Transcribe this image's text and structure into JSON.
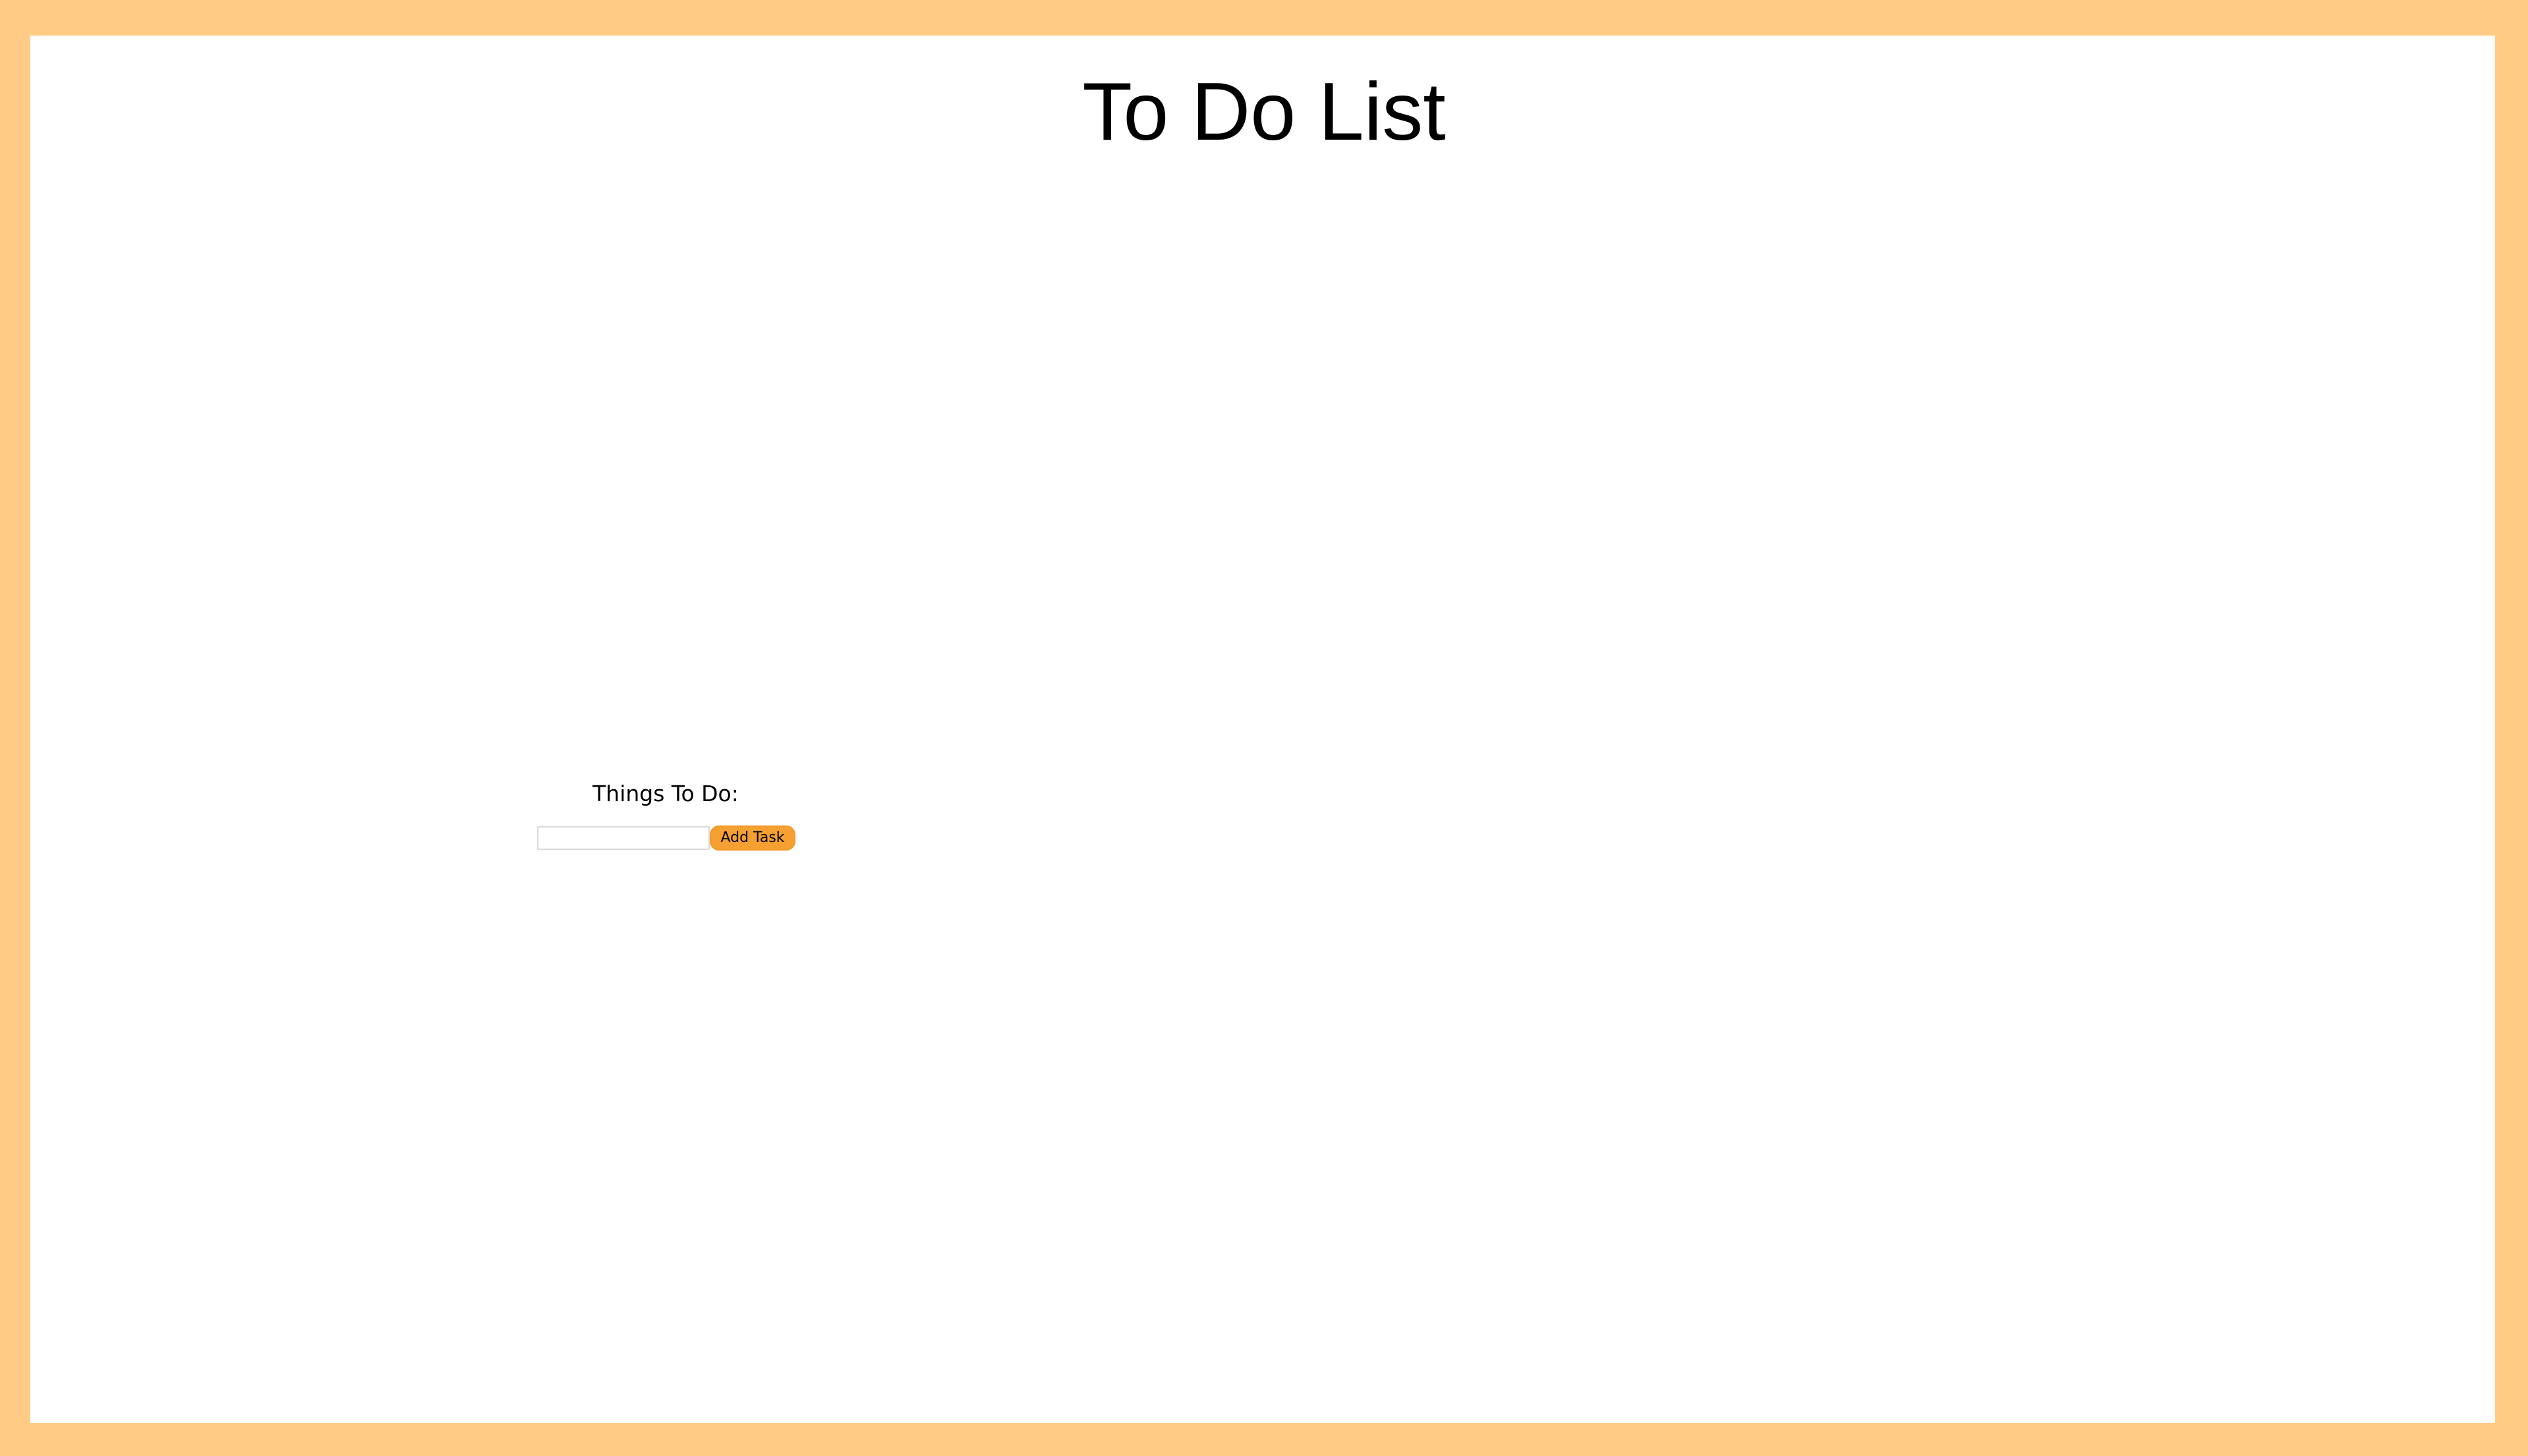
{
  "header": {
    "title": "To Do List"
  },
  "todo": {
    "heading": "Things To Do:",
    "input_value": "",
    "input_placeholder": "",
    "add_button_label": "Add Task"
  },
  "colors": {
    "frame_border": "#FFCB85",
    "button_background": "#F5A031",
    "page_background": "#FFFFFF"
  }
}
